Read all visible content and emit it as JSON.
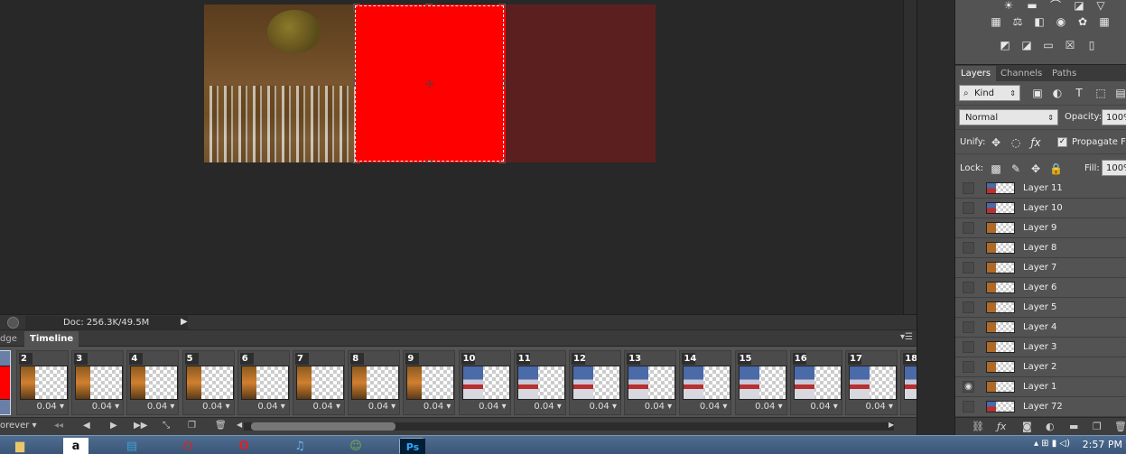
{
  "canvas": {
    "selection_cursor": "crosshair-icon"
  },
  "status_bar": {
    "doc_info": "Doc: 256.3K/49.5M"
  },
  "timeline": {
    "tabs": [
      {
        "label": "dge"
      },
      {
        "label": "Timeline"
      }
    ],
    "frames": [
      {
        "number": "",
        "delay": "",
        "thumb": "red"
      },
      {
        "number": "2",
        "delay": "0.04",
        "thumb": "fire"
      },
      {
        "number": "3",
        "delay": "0.04",
        "thumb": "fire"
      },
      {
        "number": "4",
        "delay": "0.04",
        "thumb": "fire"
      },
      {
        "number": "5",
        "delay": "0.04",
        "thumb": "fire"
      },
      {
        "number": "6",
        "delay": "0.04",
        "thumb": "fire"
      },
      {
        "number": "7",
        "delay": "0.04",
        "thumb": "fire"
      },
      {
        "number": "8",
        "delay": "0.04",
        "thumb": "fire"
      },
      {
        "number": "9",
        "delay": "0.04",
        "thumb": "fire"
      },
      {
        "number": "10",
        "delay": "0.04",
        "thumb": "flag"
      },
      {
        "number": "11",
        "delay": "0.04",
        "thumb": "flag"
      },
      {
        "number": "12",
        "delay": "0.04",
        "thumb": "flag"
      },
      {
        "number": "13",
        "delay": "0.04",
        "thumb": "flag"
      },
      {
        "number": "14",
        "delay": "0.04",
        "thumb": "flag"
      },
      {
        "number": "15",
        "delay": "0.04",
        "thumb": "flag"
      },
      {
        "number": "16",
        "delay": "0.04",
        "thumb": "flag"
      },
      {
        "number": "17",
        "delay": "0.04",
        "thumb": "flag"
      },
      {
        "number": "18",
        "delay": "",
        "thumb": "flag"
      }
    ],
    "loop_label": "orever"
  },
  "layers_panel": {
    "tabs": [
      "Layers",
      "Channels",
      "Paths"
    ],
    "kind_label": "Kind",
    "blend_mode": "Normal",
    "opacity_label": "Opacity:",
    "opacity_value": "100%",
    "unify_label": "Unify:",
    "propagate_label": "Propagate Fra",
    "lock_label": "Lock:",
    "fill_label": "Fill:",
    "fill_value": "100%",
    "layers": [
      {
        "name": "Layer 11",
        "visible": false,
        "thumb": "flag"
      },
      {
        "name": "Layer 10",
        "visible": false,
        "thumb": "flag"
      },
      {
        "name": "Layer 9",
        "visible": false,
        "thumb": "fire"
      },
      {
        "name": "Layer 8",
        "visible": false,
        "thumb": "fire"
      },
      {
        "name": "Layer 7",
        "visible": false,
        "thumb": "fire"
      },
      {
        "name": "Layer 6",
        "visible": false,
        "thumb": "fire"
      },
      {
        "name": "Layer 5",
        "visible": false,
        "thumb": "fire"
      },
      {
        "name": "Layer 4",
        "visible": false,
        "thumb": "fire"
      },
      {
        "name": "Layer 3",
        "visible": false,
        "thumb": "fire"
      },
      {
        "name": "Layer 2",
        "visible": false,
        "thumb": "fire"
      },
      {
        "name": "Layer 1",
        "visible": true,
        "thumb": "fire"
      },
      {
        "name": "Layer 72",
        "visible": false,
        "thumb": "flag"
      }
    ]
  },
  "taskbar": {
    "apps": [
      {
        "name": "folder-icon",
        "glyph": "▆",
        "color": "#e8c86a"
      },
      {
        "name": "amazon-icon",
        "glyph": "a",
        "color": "#111111"
      },
      {
        "name": "notes-icon",
        "glyph": "▤",
        "color": "#3aa0d8"
      },
      {
        "name": "power-icon",
        "glyph": "⏻",
        "color": "#c0302a"
      },
      {
        "name": "opera-icon",
        "glyph": "O",
        "color": "#e0202a"
      },
      {
        "name": "itunes-icon",
        "glyph": "♫",
        "color": "#6ab4e8"
      },
      {
        "name": "people-icon",
        "glyph": "☺",
        "color": "#7ab04a"
      },
      {
        "name": "photoshop-icon",
        "glyph": "Ps",
        "color": "#31a8ff"
      }
    ],
    "time": "2:57 PM"
  }
}
